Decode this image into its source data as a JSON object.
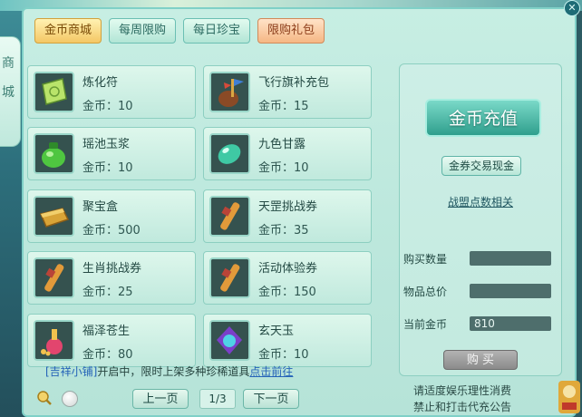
{
  "side_tab": {
    "chars": [
      "商",
      "城"
    ]
  },
  "tabs": [
    {
      "label": "金币商城",
      "state": "active"
    },
    {
      "label": "每周限购",
      "state": "normal"
    },
    {
      "label": "每日珍宝",
      "state": "normal"
    },
    {
      "label": "限购礼包",
      "state": "special"
    }
  ],
  "items": [
    {
      "name": "炼化符",
      "price": "金币：10",
      "icon": "talisman-icon"
    },
    {
      "name": "飞行旗补充包",
      "price": "金币：15",
      "icon": "flag-pouch-icon"
    },
    {
      "name": "瑶池玉浆",
      "price": "金币：10",
      "icon": "green-pouch-icon"
    },
    {
      "name": "九色甘露",
      "price": "金币：10",
      "icon": "dew-gem-icon"
    },
    {
      "name": "聚宝盒",
      "price": "金币：500",
      "icon": "treasure-box-icon"
    },
    {
      "name": "天罡挑战券",
      "price": "金币：35",
      "icon": "scroll-icon"
    },
    {
      "name": "生肖挑战券",
      "price": "金币：25",
      "icon": "scroll-icon"
    },
    {
      "name": "活动体验券",
      "price": "金币：150",
      "icon": "scroll-icon"
    },
    {
      "name": "福泽苍生",
      "price": "金币：80",
      "icon": "potion-icon"
    },
    {
      "name": "玄天玉",
      "price": "金币：10",
      "icon": "jade-gem-icon"
    }
  ],
  "right": {
    "recharge_label": "金币充值",
    "exchange_label": "金券交易现金",
    "alliance_label": "战盟点数相关",
    "qty_label": "购买数量",
    "qty_value": "",
    "total_label": "物品总价",
    "total_value": "",
    "gold_label": "当前金币",
    "gold_value": "810",
    "buy_label": "购 买"
  },
  "notice": {
    "shop": "[吉祥小铺]",
    "text": "开启中，限时上架多种珍稀道具",
    "link": "点击前往"
  },
  "pager": {
    "prev": "上一页",
    "page": "1/3",
    "next": "下一页"
  },
  "health_notice": [
    "请适度娱乐理性消费",
    "禁止和打击代充公告"
  ],
  "colors": {
    "accent_gold": "#f4c764",
    "panel": "#c7eee3",
    "recharge": "#2f9f8d"
  }
}
